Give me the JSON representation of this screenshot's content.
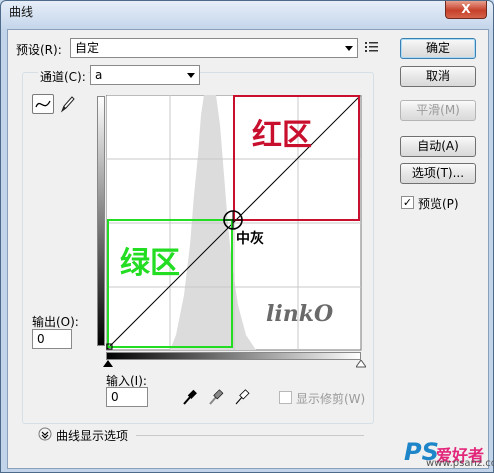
{
  "window": {
    "title": "曲线",
    "close_glyph": "X"
  },
  "preset": {
    "label": "预设(R):",
    "value": "自定",
    "menu_icon": "list-menu-icon"
  },
  "channel": {
    "label": "通道(C):",
    "value": "a"
  },
  "buttons": {
    "ok": "确定",
    "cancel": "取消",
    "smooth": "平滑(M)",
    "auto": "自动(A)",
    "options": "选项(T)...",
    "preview": "预览(P)"
  },
  "preview_checked": true,
  "output": {
    "label": "输出(O):",
    "value": "0"
  },
  "input": {
    "label": "输入(I):",
    "value": "0"
  },
  "show_clipping": {
    "label": "显示修剪(W)",
    "checked": false
  },
  "curve_options": {
    "label": "曲线显示选项"
  },
  "curve": {
    "red_zone_label": "红区",
    "green_zone_label": "绿区",
    "mid_gray_label": "中灰",
    "watermark": "linkO",
    "red_color": "#c8102e",
    "green_color": "#22dd22"
  },
  "footer_watermark": {
    "brand": "PS",
    "brand_rest": "爱好者",
    "site": "www.psanz.com"
  }
}
